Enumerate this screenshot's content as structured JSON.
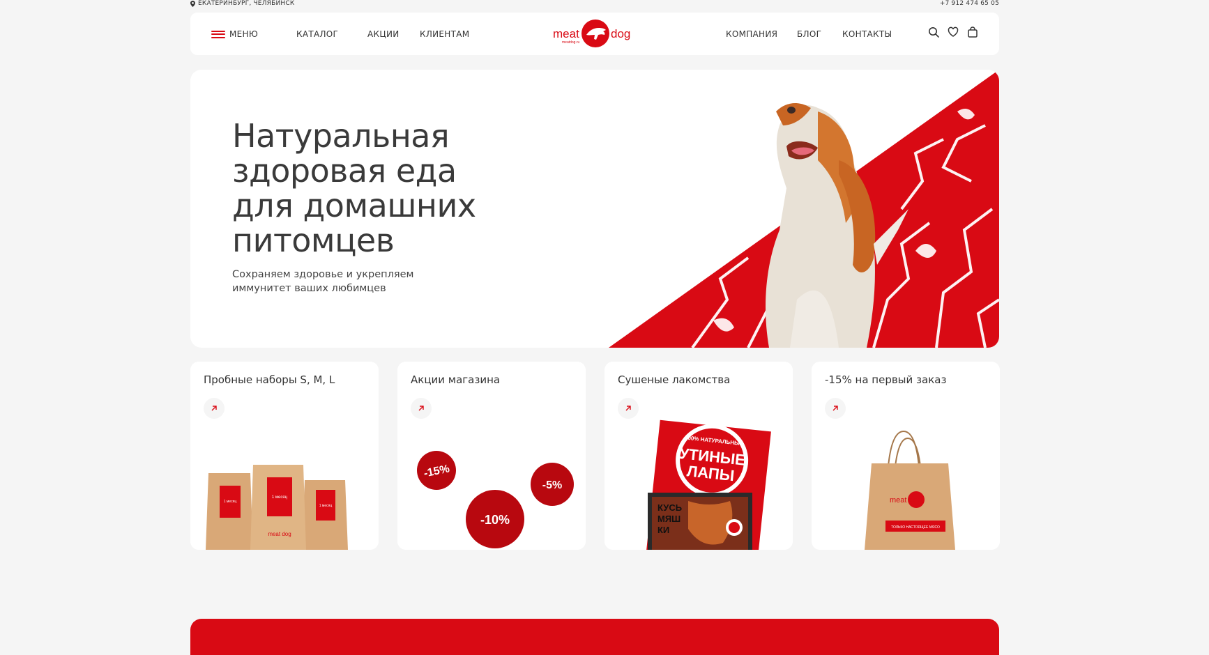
{
  "topbar": {
    "city": "ЕКАТЕРИНБУРГ, ЧЕЛЯБИНСК",
    "phone": "+7 912 474 65 05"
  },
  "header": {
    "menu": "МЕНЮ",
    "nav_left": [
      "КАТАЛОГ",
      "АКЦИИ",
      "КЛИЕНТАМ"
    ],
    "nav_right": [
      "КОМПАНИЯ",
      "БЛОГ",
      "КОНТАКТЫ"
    ],
    "logo": {
      "left": "meat",
      "right": "dog",
      "sub": "meatdog.ru"
    }
  },
  "hero": {
    "title": "Натуральная здоровая еда для домашних питомцев",
    "subtitle": "Сохраняем здоровье и укрепляем иммунитет ваших любимцев"
  },
  "cards": [
    {
      "title": "Пробные наборы S, M, L",
      "bag_label": "1 месяц",
      "brand": "meat dog"
    },
    {
      "title": "Акции магазина",
      "badges": [
        "-15%",
        "-10%",
        "-5%"
      ]
    },
    {
      "title": "Сушеные лакомства",
      "pack_top": "100% НАТУРАЛЬНЫЕ",
      "pack_title_1": "УТИНЫЕ",
      "pack_title_2": "ЛАПЫ",
      "pack_brand_1": "КУСЬ",
      "pack_brand_2": "МЯШ",
      "pack_brand_3": "КИ"
    },
    {
      "title": "-15% на первый заказ",
      "bag_brand": "meat dog",
      "bag_tag": "ТОЛЬКО НАСТОЯЩЕЕ МЯСО"
    }
  ],
  "colors": {
    "brand": "#d90a14",
    "bg": "#f5f5f5",
    "text": "#333333",
    "kraft": "#d9a877"
  }
}
